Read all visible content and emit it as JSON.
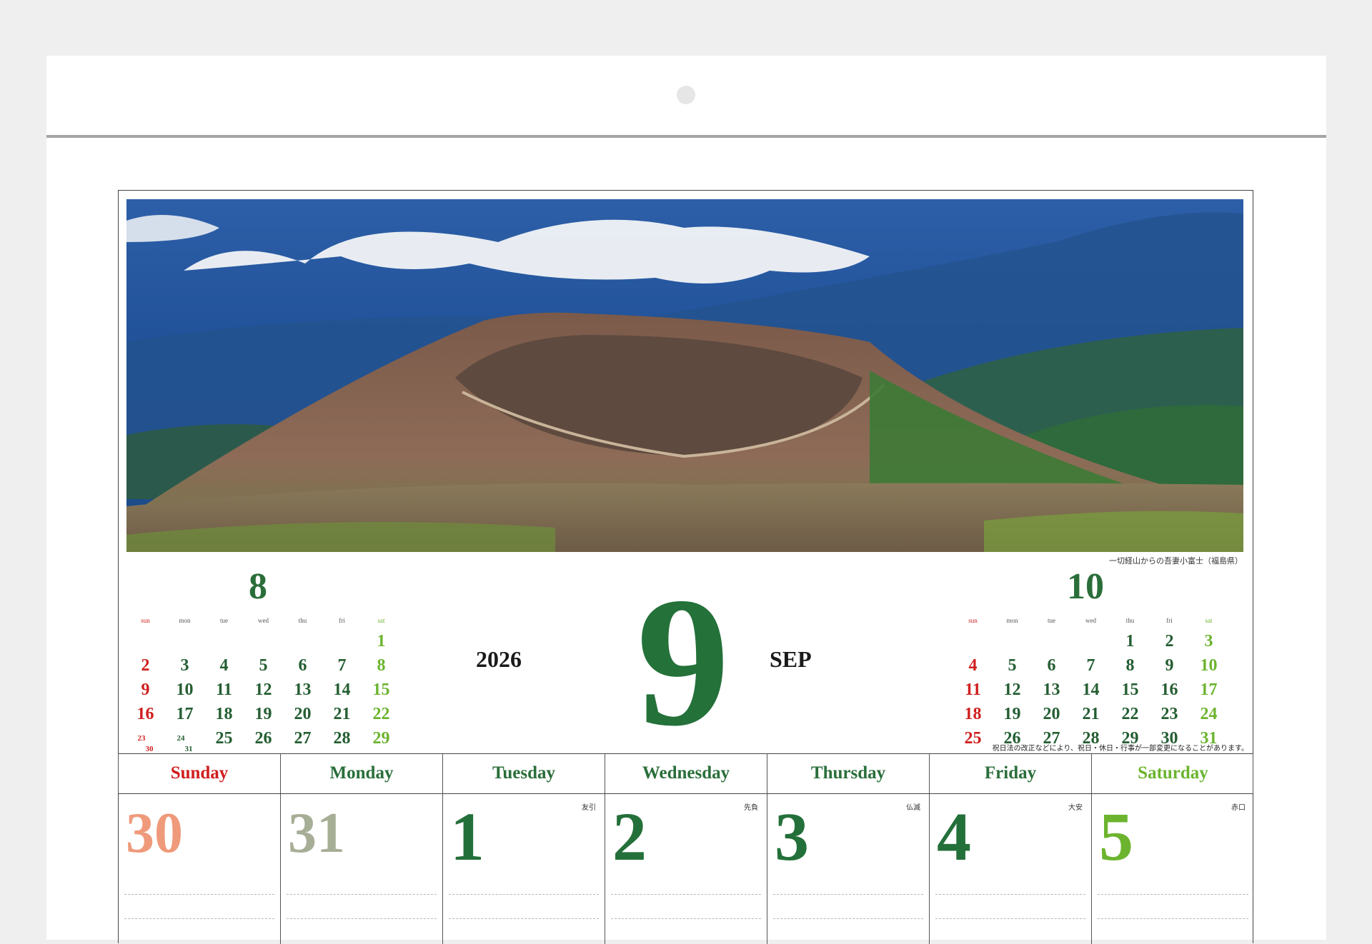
{
  "photo_caption": "一切経山からの吾妻小富士（福島県）",
  "year": "2026",
  "month_number": "9",
  "month_abbr": "SEP",
  "holiday_note": "祝日法の改正などにより、祝日・休日・行事が一部変更になることがあります。",
  "prev_month": {
    "title": "8",
    "dow": [
      "sun",
      "mon",
      "tue",
      "wed",
      "thu",
      "fri",
      "sat"
    ],
    "rows": [
      [
        "",
        "",
        "",
        "",
        "",
        "",
        "1"
      ],
      [
        "2",
        "3",
        "4",
        "5",
        "6",
        "7",
        "8"
      ],
      [
        "9",
        "10",
        "11",
        "12",
        "13",
        "14",
        "15"
      ],
      [
        "16",
        "17",
        "18",
        "19",
        "20",
        "21",
        "22"
      ],
      [
        "23/30",
        "24/31",
        "25",
        "26",
        "27",
        "28",
        "29"
      ]
    ]
  },
  "next_month": {
    "title": "10",
    "dow": [
      "sun",
      "mon",
      "tue",
      "wed",
      "thu",
      "fri",
      "sat"
    ],
    "rows": [
      [
        "",
        "",
        "",
        "",
        "1",
        "2",
        "3"
      ],
      [
        "4",
        "5",
        "6",
        "7",
        "8",
        "9",
        "10"
      ],
      [
        "11",
        "12",
        "13",
        "14",
        "15",
        "16",
        "17"
      ],
      [
        "18",
        "19",
        "20",
        "21",
        "22",
        "23",
        "24"
      ],
      [
        "25",
        "26",
        "27",
        "28",
        "29",
        "30",
        "31"
      ]
    ]
  },
  "weekdays": [
    "Sunday",
    "Monday",
    "Tuesday",
    "Wednesday",
    "Thursday",
    "Friday",
    "Saturday"
  ],
  "first_week": [
    {
      "day": "30",
      "rokuyo": ""
    },
    {
      "day": "31",
      "rokuyo": ""
    },
    {
      "day": "1",
      "rokuyo": "友引"
    },
    {
      "day": "2",
      "rokuyo": "先負"
    },
    {
      "day": "3",
      "rokuyo": "仏滅"
    },
    {
      "day": "4",
      "rokuyo": "大安"
    },
    {
      "day": "5",
      "rokuyo": "赤口"
    }
  ],
  "colors": {
    "green": "#24703a",
    "sunday_red": "#d01e1e",
    "saturday_green": "#6cb42f",
    "prev_sunday": "#ef9a7b",
    "prev_monday": "#a7ae96"
  }
}
